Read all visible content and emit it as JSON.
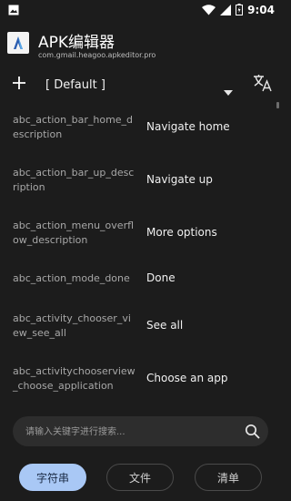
{
  "status_bar": {
    "time": "9:04",
    "icons": [
      "image-icon",
      "wifi-icon",
      "signal-icon",
      "battery-icon"
    ]
  },
  "app": {
    "title": "APK编辑器",
    "package": "com.gmail.heagoo.apkeditor.pro"
  },
  "toolbar": {
    "language_selected": "[ Default ]",
    "icons": [
      "add-icon",
      "dropdown-caret-icon",
      "translate-icon"
    ]
  },
  "strings": [
    {
      "key": "abc_action_bar_home_description",
      "value": "Navigate home"
    },
    {
      "key": "abc_action_bar_up_description",
      "value": "Navigate up"
    },
    {
      "key": "abc_action_menu_overflow_description",
      "value": "More options"
    },
    {
      "key": "abc_action_mode_done",
      "value": "Done"
    },
    {
      "key": "abc_activity_chooser_view_see_all",
      "value": "See all"
    },
    {
      "key": "abc_activitychooserview_choose_application",
      "value": "Choose an app"
    }
  ],
  "search": {
    "placeholder": "请输入关键字进行搜索...",
    "value": ""
  },
  "tabs": [
    {
      "label": "字符串",
      "active": true
    },
    {
      "label": "文件",
      "active": false
    },
    {
      "label": "清单",
      "active": false
    }
  ],
  "colors": {
    "background": "#1c1c1c",
    "active_tab": "#a9c8f5",
    "search_bg": "#2d2d2d"
  }
}
